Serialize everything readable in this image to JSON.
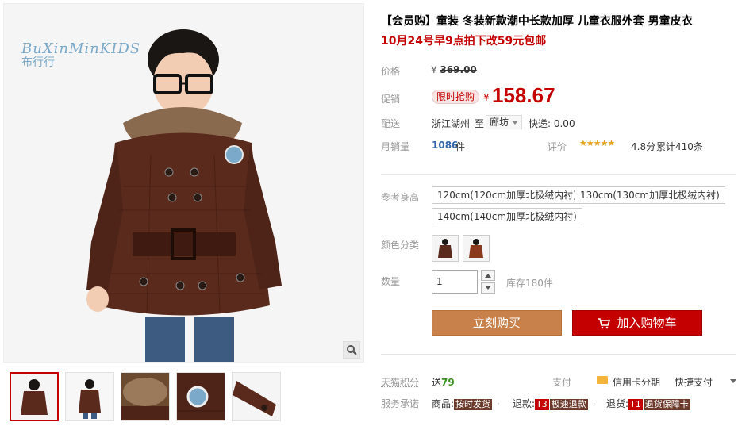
{
  "gallery": {
    "brand_line1": "BuXinMinKIDS",
    "brand_line2": "布行行",
    "zoom_icon": "magnifier-icon"
  },
  "product": {
    "title": "【会员购】童装 冬装新款潮中长款加厚 儿童衣服外套 男童皮衣",
    "subtitle": "10月24号早9点拍下改59元包邮"
  },
  "price": {
    "label": "价格",
    "currency": "¥",
    "original": "369.00",
    "promo_label": "促销",
    "promo_tag": "限时抢购",
    "current": "158.67"
  },
  "shipping": {
    "label": "配送",
    "from": "浙江湖州",
    "to_label": "至",
    "destination": "廊坊",
    "fee": "快递: 0.00"
  },
  "sales": {
    "label": "月销量",
    "count": "1086",
    "unit": "件",
    "rating_label": "评价",
    "stars": "★★★★★",
    "score": "4.8分",
    "total": "累计410条"
  },
  "options": {
    "size_label": "参考身高",
    "sizes": [
      "120cm(120cm加厚北极绒内衬)",
      "130cm(130cm加厚北极绒内衬)",
      "140cm(140cm加厚北极绒内衬)"
    ],
    "color_label": "颜色分类",
    "qty_label": "数量",
    "qty_value": "1",
    "stock": "库存180件"
  },
  "actions": {
    "buy_now": "立刻购买",
    "add_to_cart": "加入购物车"
  },
  "footer": {
    "points_label": "天猫积分",
    "points_prefix": "送",
    "points_value": "79",
    "pay_label": "支付",
    "card_text": "信用卡分期",
    "quick_pay": "快捷支付",
    "service_label": "服务承诺",
    "svc1_prefix": "商品:",
    "svc1_badge": "按时发货",
    "svc2_prefix": "退款:",
    "svc2_tag": "T3",
    "svc2_badge": "极速退款",
    "svc3_prefix": "退货:",
    "svc3_tag": "T1",
    "svc3_badge": "退货保障卡"
  },
  "colors": {
    "accent_red": "#c40000",
    "buy_button": "#c8814a",
    "jacket_brown": "#5a2a1c"
  }
}
